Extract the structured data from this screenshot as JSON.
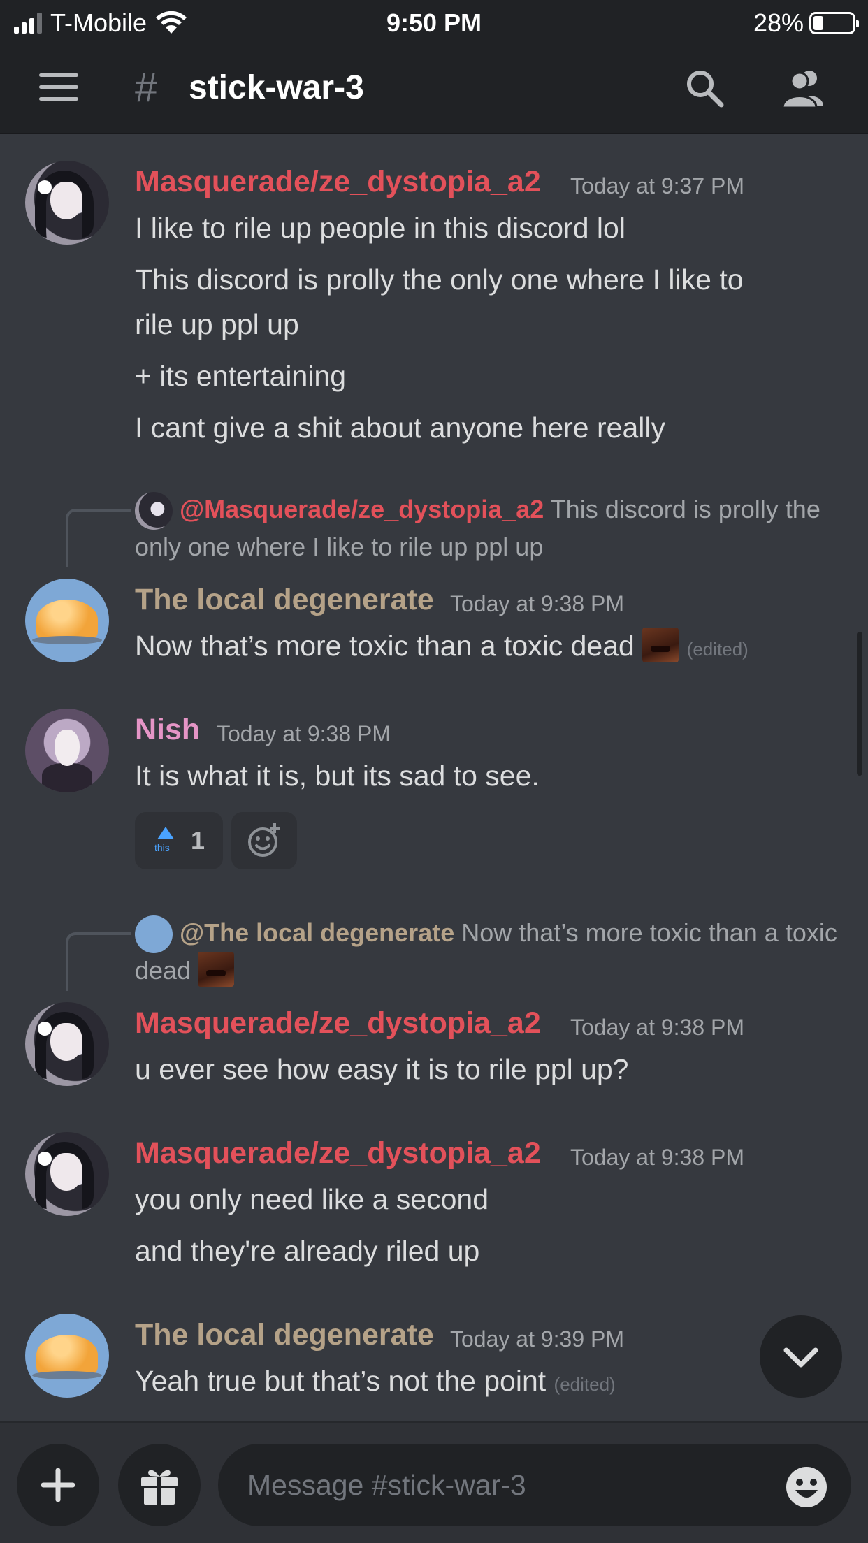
{
  "status_bar": {
    "carrier": "T-Mobile",
    "time": "9:50 PM",
    "battery": "28%"
  },
  "header": {
    "channel_hash": "#",
    "channel_name": "stick-war-3"
  },
  "messages": {
    "m1": {
      "username": "Masquerade/ze_dystopia_a2",
      "timestamp": "Today at 9:37 PM",
      "lines": [
        "I like to rile up people in this discord lol",
        "This discord is prolly the only one where I like to",
        "rile up ppl up",
        "+ its entertaining",
        "I cant give a shit about anyone here really"
      ]
    },
    "m2": {
      "reply_mention": "@Masquerade/ze_dystopia_a2",
      "reply_text_1": "This discord is prolly",
      "reply_text_2": "the only one where I like to rile up ppl up",
      "username": "The local degenerate",
      "timestamp": "Today at 9:38 PM",
      "text": "Now that’s more toxic than a toxic dead",
      "edited": "(edited)"
    },
    "m3": {
      "username": "Nish",
      "timestamp": "Today at 9:38 PM",
      "text": "It is what it is, but its sad to see.",
      "reaction_count": "1"
    },
    "m4": {
      "reply_mention": "@The local degenerate",
      "reply_text_1": "Now that’s more toxic than a",
      "reply_text_2": "toxic dead",
      "username": "Masquerade/ze_dystopia_a2",
      "timestamp": "Today at 9:38 PM",
      "text": "u ever see how easy it is to rile ppl up?"
    },
    "m5": {
      "username": "Masquerade/ze_dystopia_a2",
      "timestamp": "Today at 9:38 PM",
      "lines": [
        "you only need like a second",
        "and they're already riled up"
      ]
    },
    "m6": {
      "username": "The local degenerate",
      "timestamp": "Today at 9:39 PM",
      "text": "Yeah true but that’s not the point",
      "edited": "(edited)"
    }
  },
  "composer": {
    "placeholder": "Message #stick-war-3"
  },
  "colors": {
    "background": "#36393f",
    "header": "#202225",
    "masquerade_name": "#e3515a",
    "degenerate_name": "#b5a288",
    "nish_name": "#e595c6"
  },
  "icons": [
    "hamburger-menu-icon",
    "search-icon",
    "members-icon",
    "upvote-this-icon",
    "add-reaction-icon",
    "chevron-down-icon",
    "plus-icon",
    "gift-icon",
    "emoji-icon",
    "wifi-icon"
  ]
}
